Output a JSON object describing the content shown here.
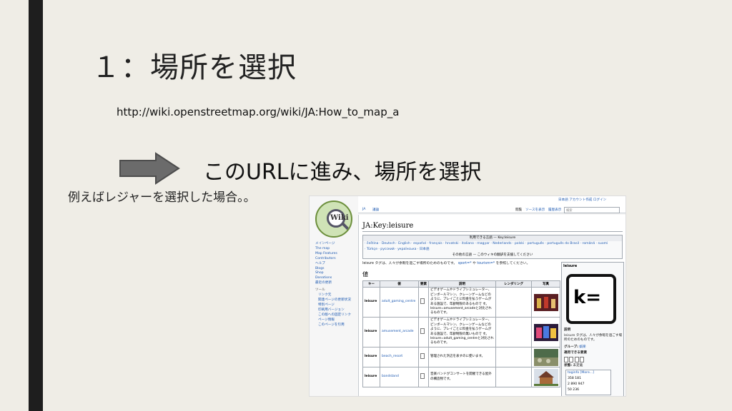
{
  "slide": {
    "title": "１：場所を選択",
    "url": "http://wiki.openstreetmap.org/wiki/JA:How_to_map_a",
    "instruction": "このURLに進み、場所を選択",
    "example": "例えばレジャーを選択した場合。。",
    "arrow_color": "#6b6b6b",
    "background": "#efede6"
  },
  "screenshot": {
    "logo_text": "Wiki",
    "sidebar": {
      "nav": [
        "メインページ",
        "The map",
        "Map Features",
        "Contributors",
        "ヘルプ",
        "Blogs",
        "Shop",
        "Donations",
        "最近の更新"
      ],
      "tools_heading": "ツール",
      "tools": [
        "リンク元",
        "関連ページの更新状況",
        "特別ページ",
        "印刷用バージョン",
        "この版への固定リンク",
        "ページ情報",
        "このページを引用"
      ]
    },
    "topbar": {
      "user_links": "日本語  アカウント作成  ログイン",
      "tabs": [
        "JA",
        "議論"
      ],
      "actions": [
        "閲覧",
        "ソースを表示",
        "履歴表示"
      ],
      "search_placeholder": "検索"
    },
    "page_title": "JA:Key:leisure",
    "lang_box": {
      "header": "利用できる言語 — Key:leisure",
      "line1": "· čeština · Deutsch · English · español · français · hrvatski · italiano · magyar · Nederlands · polski · português · português do Brasil · română · suomi",
      "line2": "· Türkçe · русский · українська · 日本語",
      "footer": "その他の言語 — このウィキの翻訳を支援してください"
    },
    "intro": {
      "text": "leisure タグは、人々が余暇を過ごす場所のためのものです。",
      "link1": "sport=*",
      "mid": "や",
      "link2": "tourism=*",
      "end": "を参照してください。"
    },
    "values_heading": "値",
    "table": {
      "headers": [
        "キー",
        "値",
        "要素",
        "説明",
        "レンダリング",
        "写真"
      ],
      "rows": [
        {
          "key": "leisure",
          "value": "adult_gaming_centre",
          "desc": "ビデオゲームやドライブシミュレーター、ピンボールマシン、クレーンゲームなどのように、プレイごとに料金を払うゲームがある施設で、年齢制限のあるもので す。leisure=amusement_arcadeと対比されるものです。"
        },
        {
          "key": "leisure",
          "value": "amusement_arcade",
          "desc": "ビデオゲームやドライブシミュレーター、ピンボールマシン、クレーンゲームなどのように、プレイごとに料金を払うゲームがある施設で、年齢制限の無いもので す。leisure=adult_gaming_centreと対比されるものです。"
        },
        {
          "key": "leisure",
          "value": "beach_resort",
          "desc": "管理された浜辺を表すのに使います。"
        },
        {
          "key": "leisure",
          "value": "bandstand",
          "desc": "音楽バンドがコンサートを開催できる屋外の構造物です。"
        }
      ]
    },
    "infobox": {
      "header": "leisure",
      "icon_text": "k=",
      "desc_label": "説明",
      "desc": "leisure タグは、人々が余暇を過ごす場所のためのものです。",
      "group_label": "グループ:",
      "group_value": "娯楽",
      "applies_label": "適用できる要素",
      "status_label": "状態:",
      "status_value": "未定義",
      "taginfo_label": "taginfo [More...]",
      "counts": [
        "358 181",
        "2 890 947",
        "50 236"
      ]
    }
  }
}
